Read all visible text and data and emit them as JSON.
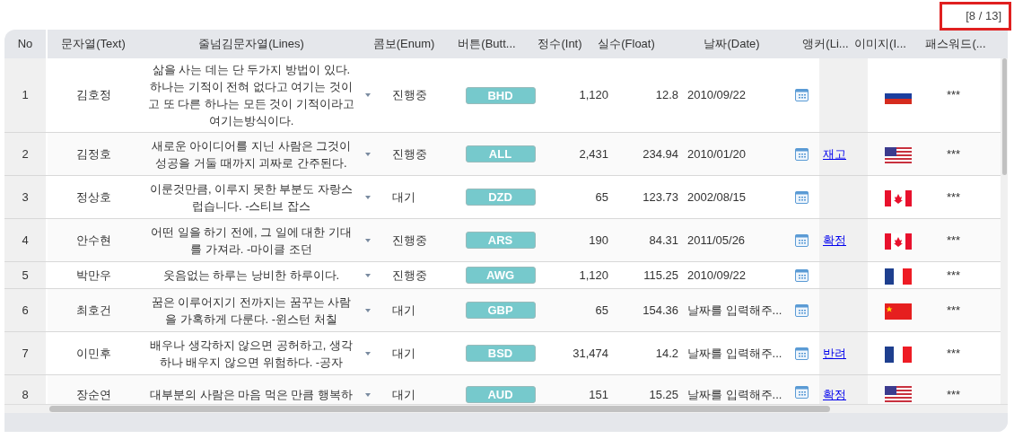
{
  "pager": "[8 / 13]",
  "columns": [
    "No",
    "문자열(Text)",
    "줄넘김문자열(Lines)",
    "콤보(Enum)",
    "버튼(Butt...",
    "정수(Int)",
    "실수(Float)",
    "날짜(Date)",
    "앵커(Li...",
    "이미지(I...",
    "패스워드(..."
  ],
  "rows": [
    {
      "no": "1",
      "text": "김호정",
      "lines": "삶을 사는 데는 단 두가지 방법이 있다. 하나는 기적이 전혀 없다고 여기는 것이고 또 다른 하나는 모든 것이 기적이라고 여기는방식이다.",
      "enum": "진행중",
      "button": "BHD",
      "int": "1,120",
      "float": "12.8",
      "date": "2010/09/22",
      "kind": "ru",
      "password": "***"
    },
    {
      "no": "2",
      "text": "김정호",
      "lines": "새로운 아이디어를 지닌 사람은 그것이 성공을 거둘 때까지 괴짜로 간주된다.",
      "enum": "진행중",
      "button": "ALL",
      "int": "2,431",
      "float": "234.94",
      "date": "2010/01/20",
      "anchor": "재고",
      "kind": "us",
      "password": "***"
    },
    {
      "no": "3",
      "text": "정상호",
      "lines": "이룬것만큼, 이루지 못한 부분도 자랑스럽습니다. -스티브 잡스",
      "enum": "대기",
      "button": "DZD",
      "int": "65",
      "float": "123.73",
      "date": "2002/08/15",
      "kind": "ca",
      "password": "***"
    },
    {
      "no": "4",
      "text": "안수현",
      "lines": "어떤 일을 하기 전에, 그 일에 대한 기대를 가져라. -마이클 조던",
      "enum": "진행중",
      "button": "ARS",
      "int": "190",
      "float": "84.31",
      "date": "2011/05/26",
      "anchor": "확정",
      "kind": "ca",
      "password": "***"
    },
    {
      "no": "5",
      "text": "박만우",
      "lines": "웃음없는 하루는 낭비한 하루이다.",
      "enum": "진행중",
      "button": "AWG",
      "int": "1,120",
      "float": "115.25",
      "date": "2010/09/22",
      "kind": "fr",
      "password": "***"
    },
    {
      "no": "6",
      "text": "최호건",
      "lines": "꿈은 이루어지기 전까지는 꿈꾸는 사람을 가혹하게 다룬다. -윈스턴 처칠",
      "enum": "대기",
      "button": "GBP",
      "int": "65",
      "float": "154.36",
      "date": "날짜를 입력해주...",
      "kind": "cn",
      "password": "***"
    },
    {
      "no": "7",
      "text": "이민후",
      "lines": "배우나 생각하지 않으면 공허하고, 생각하나 배우지 않으면 위험하다. -공자",
      "enum": "대기",
      "button": "BSD",
      "int": "31,474",
      "float": "14.2",
      "date": "날짜를 입력해주...",
      "anchor": "반려",
      "kind": "fr",
      "password": "***"
    },
    {
      "no": "8",
      "text": "장순연",
      "lines": "대부분의 사람은 마음 먹은 만큼 행복하",
      "enum": "대기",
      "button": "AUD",
      "int": "151",
      "float": "15.25",
      "date": "날짜를 입력해주...",
      "anchor": "확정",
      "kind": "us",
      "password": "***"
    }
  ]
}
